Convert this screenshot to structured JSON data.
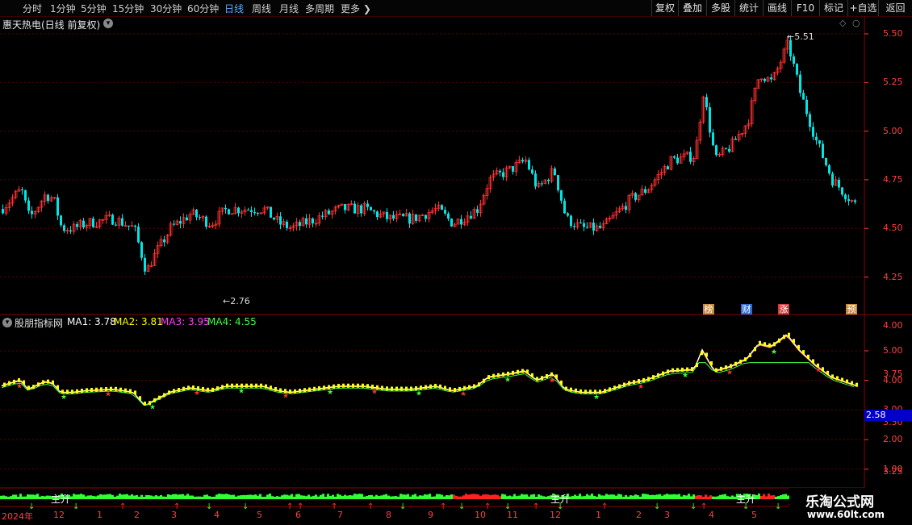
{
  "toolbar": {
    "periods": [
      "分时",
      "1分钟",
      "5分钟",
      "15分钟",
      "30分钟",
      "60分钟",
      "日线",
      "周线",
      "月线",
      "多周期",
      "更多"
    ],
    "active_period": "日线",
    "right_buttons": [
      "复权",
      "叠加",
      "多股",
      "统计",
      "画线",
      "F10",
      "标记",
      "+自选",
      "返回"
    ]
  },
  "main": {
    "title": "惠天热电(日线 前复权)",
    "high_label": "5.51",
    "low_label": "2.76",
    "y_ticks": [
      "5.50",
      "5.25",
      "5.00",
      "4.75",
      "4.50",
      "4.25",
      "4.00",
      "3.75",
      "3.50",
      "3.25",
      "3.00"
    ],
    "badges": [
      "榜",
      "财",
      "涨",
      "预"
    ]
  },
  "indicator": {
    "name": "股朋指标网",
    "ma1": "MA1: 3.78",
    "ma2": "MA2: 3.81",
    "ma3": "MA3: 3.95",
    "ma4": "MA4: 4.55",
    "y_ticks": [
      "5.00",
      "4.00",
      "3.00",
      "2.00",
      "1.00"
    ],
    "current_value": "2.58"
  },
  "bottom": {
    "signal_labels": [
      "主升",
      "主升",
      "主升"
    ],
    "date_labels": [
      "2024年",
      "12",
      "1",
      "2",
      "3",
      "4",
      "5",
      "6",
      "7",
      "8",
      "9",
      "10",
      "11",
      "12",
      "1",
      "2",
      "3",
      "4",
      "5"
    ]
  },
  "watermark": {
    "line1": "乐淘公式网",
    "line2": "www.60lt.com"
  },
  "colors": {
    "up": "#ff3030",
    "down": "#00e5e5",
    "grid": "#5a0000",
    "ma1": "#ffffff",
    "ma2": "#ffff00",
    "ma3": "#ff40ff",
    "ma4": "#40ff40"
  }
}
